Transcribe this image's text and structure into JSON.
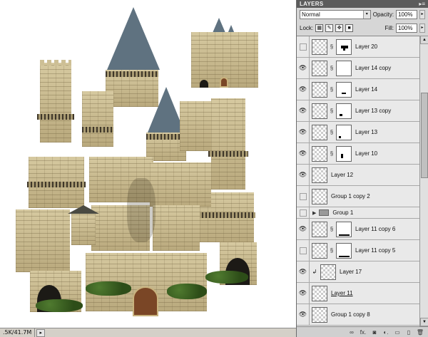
{
  "canvas": {
    "description_icons": [
      "castle-tower",
      "castle-wall",
      "wooden-door",
      "bush"
    ]
  },
  "statusbar": {
    "doc_size": ".5K/41.7M",
    "arrow": "▸"
  },
  "panel": {
    "title": "LAYERS",
    "menu_glyph": "▸≡",
    "blend_mode": "Normal",
    "opacity_label": "Opacity:",
    "opacity_value": "100%",
    "lock_label": "Lock:",
    "fill_label": "Fill:",
    "fill_value": "100%",
    "layers": [
      {
        "name": "Layer 20",
        "visible": false,
        "mask": true
      },
      {
        "name": "Layer 14 copy",
        "visible": true,
        "mask": true
      },
      {
        "name": "Layer 14",
        "visible": true,
        "mask": true
      },
      {
        "name": "Layer 13 copy",
        "visible": true,
        "mask": true
      },
      {
        "name": "Layer 13",
        "visible": true,
        "mask": true
      },
      {
        "name": "Layer 10",
        "visible": true,
        "mask": true
      },
      {
        "name": "Layer 12",
        "visible": true,
        "mask": false
      },
      {
        "name": "Group 1 copy 2",
        "visible": false,
        "mask": false
      },
      {
        "name": "Group 1",
        "visible": false,
        "group": true
      },
      {
        "name": "Layer 11 copy 6",
        "visible": true,
        "mask": true
      },
      {
        "name": "Layer 11 copy 5",
        "visible": false,
        "mask": true
      },
      {
        "name": "Layer 17",
        "visible": true,
        "clipped": true
      },
      {
        "name": "Layer 11",
        "visible": true,
        "underline": true
      },
      {
        "name": "Group 1 copy 8",
        "visible": true,
        "mask": false
      }
    ],
    "footer_icons": [
      "link-icon",
      "fx-icon",
      "mask-icon",
      "adjustment-icon",
      "folder-icon",
      "new-layer-icon",
      "trash-icon"
    ],
    "footer_glyphs": [
      "∞",
      "fx.",
      "◙",
      "◐.",
      "▭",
      "▯",
      "🗑"
    ]
  },
  "colors": {
    "panel_bg": "#d6d6d6",
    "header_bg": "#5c5c5c",
    "stone": "#c8b98f",
    "roof": "#5a6b76"
  }
}
